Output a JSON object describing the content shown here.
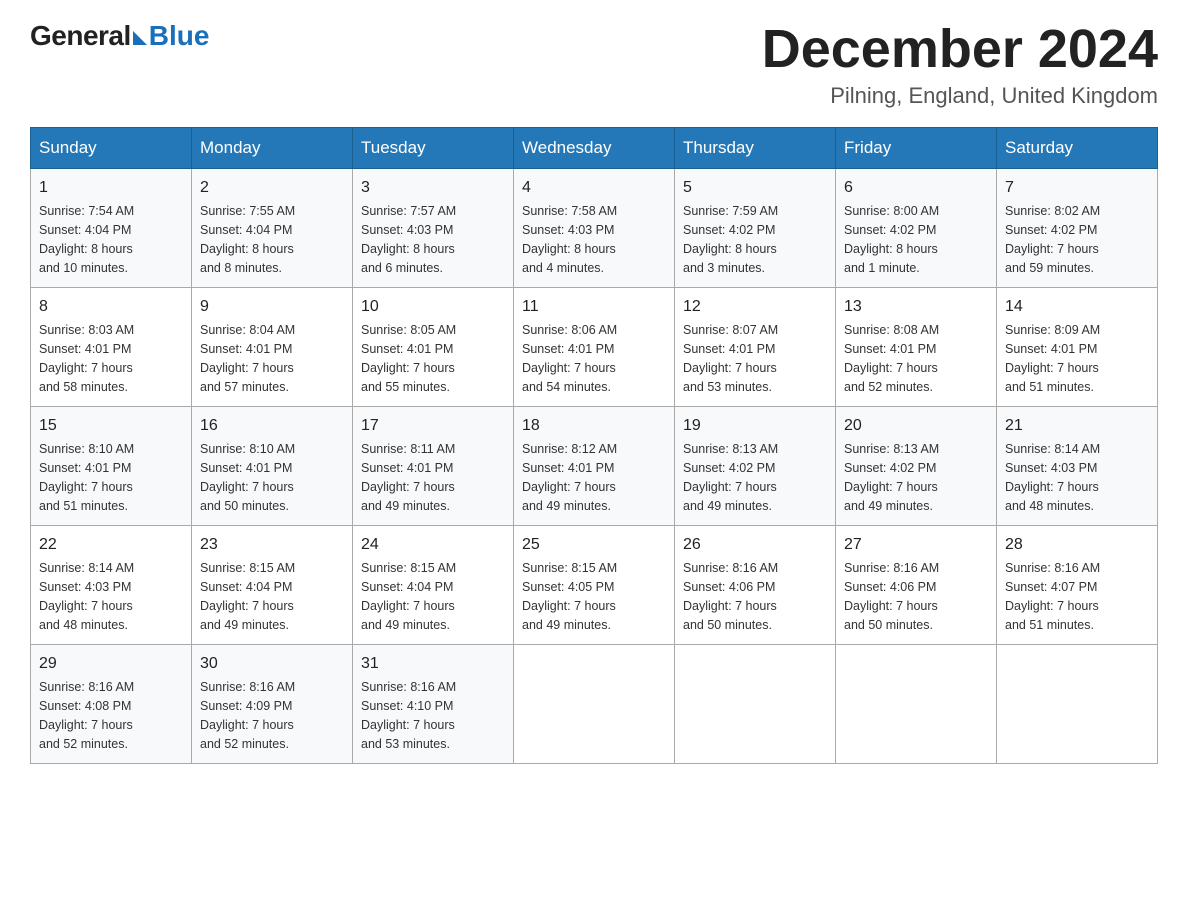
{
  "header": {
    "logo_general": "General",
    "logo_blue": "Blue",
    "month_title": "December 2024",
    "location": "Pilning, England, United Kingdom"
  },
  "days_of_week": [
    "Sunday",
    "Monday",
    "Tuesday",
    "Wednesday",
    "Thursday",
    "Friday",
    "Saturday"
  ],
  "weeks": [
    [
      {
        "day": "1",
        "info": "Sunrise: 7:54 AM\nSunset: 4:04 PM\nDaylight: 8 hours\nand 10 minutes."
      },
      {
        "day": "2",
        "info": "Sunrise: 7:55 AM\nSunset: 4:04 PM\nDaylight: 8 hours\nand 8 minutes."
      },
      {
        "day": "3",
        "info": "Sunrise: 7:57 AM\nSunset: 4:03 PM\nDaylight: 8 hours\nand 6 minutes."
      },
      {
        "day": "4",
        "info": "Sunrise: 7:58 AM\nSunset: 4:03 PM\nDaylight: 8 hours\nand 4 minutes."
      },
      {
        "day": "5",
        "info": "Sunrise: 7:59 AM\nSunset: 4:02 PM\nDaylight: 8 hours\nand 3 minutes."
      },
      {
        "day": "6",
        "info": "Sunrise: 8:00 AM\nSunset: 4:02 PM\nDaylight: 8 hours\nand 1 minute."
      },
      {
        "day": "7",
        "info": "Sunrise: 8:02 AM\nSunset: 4:02 PM\nDaylight: 7 hours\nand 59 minutes."
      }
    ],
    [
      {
        "day": "8",
        "info": "Sunrise: 8:03 AM\nSunset: 4:01 PM\nDaylight: 7 hours\nand 58 minutes."
      },
      {
        "day": "9",
        "info": "Sunrise: 8:04 AM\nSunset: 4:01 PM\nDaylight: 7 hours\nand 57 minutes."
      },
      {
        "day": "10",
        "info": "Sunrise: 8:05 AM\nSunset: 4:01 PM\nDaylight: 7 hours\nand 55 minutes."
      },
      {
        "day": "11",
        "info": "Sunrise: 8:06 AM\nSunset: 4:01 PM\nDaylight: 7 hours\nand 54 minutes."
      },
      {
        "day": "12",
        "info": "Sunrise: 8:07 AM\nSunset: 4:01 PM\nDaylight: 7 hours\nand 53 minutes."
      },
      {
        "day": "13",
        "info": "Sunrise: 8:08 AM\nSunset: 4:01 PM\nDaylight: 7 hours\nand 52 minutes."
      },
      {
        "day": "14",
        "info": "Sunrise: 8:09 AM\nSunset: 4:01 PM\nDaylight: 7 hours\nand 51 minutes."
      }
    ],
    [
      {
        "day": "15",
        "info": "Sunrise: 8:10 AM\nSunset: 4:01 PM\nDaylight: 7 hours\nand 51 minutes."
      },
      {
        "day": "16",
        "info": "Sunrise: 8:10 AM\nSunset: 4:01 PM\nDaylight: 7 hours\nand 50 minutes."
      },
      {
        "day": "17",
        "info": "Sunrise: 8:11 AM\nSunset: 4:01 PM\nDaylight: 7 hours\nand 49 minutes."
      },
      {
        "day": "18",
        "info": "Sunrise: 8:12 AM\nSunset: 4:01 PM\nDaylight: 7 hours\nand 49 minutes."
      },
      {
        "day": "19",
        "info": "Sunrise: 8:13 AM\nSunset: 4:02 PM\nDaylight: 7 hours\nand 49 minutes."
      },
      {
        "day": "20",
        "info": "Sunrise: 8:13 AM\nSunset: 4:02 PM\nDaylight: 7 hours\nand 49 minutes."
      },
      {
        "day": "21",
        "info": "Sunrise: 8:14 AM\nSunset: 4:03 PM\nDaylight: 7 hours\nand 48 minutes."
      }
    ],
    [
      {
        "day": "22",
        "info": "Sunrise: 8:14 AM\nSunset: 4:03 PM\nDaylight: 7 hours\nand 48 minutes."
      },
      {
        "day": "23",
        "info": "Sunrise: 8:15 AM\nSunset: 4:04 PM\nDaylight: 7 hours\nand 49 minutes."
      },
      {
        "day": "24",
        "info": "Sunrise: 8:15 AM\nSunset: 4:04 PM\nDaylight: 7 hours\nand 49 minutes."
      },
      {
        "day": "25",
        "info": "Sunrise: 8:15 AM\nSunset: 4:05 PM\nDaylight: 7 hours\nand 49 minutes."
      },
      {
        "day": "26",
        "info": "Sunrise: 8:16 AM\nSunset: 4:06 PM\nDaylight: 7 hours\nand 50 minutes."
      },
      {
        "day": "27",
        "info": "Sunrise: 8:16 AM\nSunset: 4:06 PM\nDaylight: 7 hours\nand 50 minutes."
      },
      {
        "day": "28",
        "info": "Sunrise: 8:16 AM\nSunset: 4:07 PM\nDaylight: 7 hours\nand 51 minutes."
      }
    ],
    [
      {
        "day": "29",
        "info": "Sunrise: 8:16 AM\nSunset: 4:08 PM\nDaylight: 7 hours\nand 52 minutes."
      },
      {
        "day": "30",
        "info": "Sunrise: 8:16 AM\nSunset: 4:09 PM\nDaylight: 7 hours\nand 52 minutes."
      },
      {
        "day": "31",
        "info": "Sunrise: 8:16 AM\nSunset: 4:10 PM\nDaylight: 7 hours\nand 53 minutes."
      },
      {
        "day": "",
        "info": ""
      },
      {
        "day": "",
        "info": ""
      },
      {
        "day": "",
        "info": ""
      },
      {
        "day": "",
        "info": ""
      }
    ]
  ]
}
